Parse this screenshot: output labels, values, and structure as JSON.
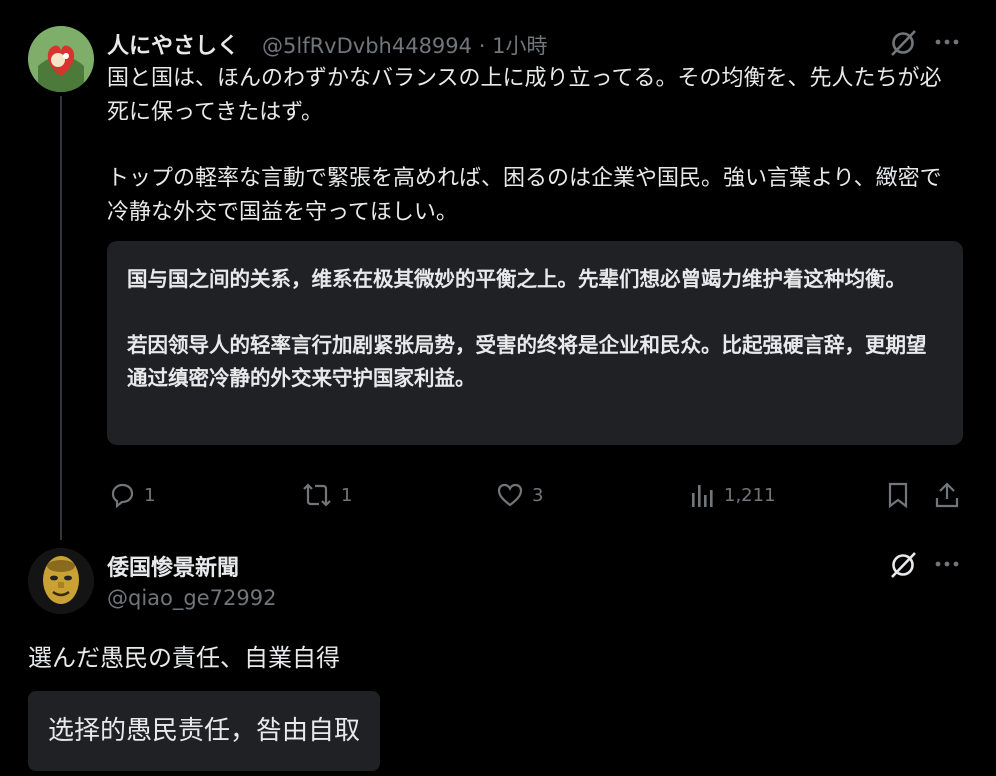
{
  "post1": {
    "display_name": "人にやさしく",
    "handle": "@5lfRvDvbh448994",
    "separator": "·",
    "time": "1小時",
    "text_p1": "国と国は、ほんのわずかなバランスの上に成り立ってる。その均衡を、先人たちが必死に保ってきたはず。",
    "text_p2": "トップの軽率な言動で緊張を高めれば、困るのは企業や国民。強い言葉より、緻密で冷静な外交で国益を守ってほしい。",
    "translation_p1": "国与国之间的关系，维系在极其微妙的平衡之上。先辈们想必曾竭力维护着这种均衡。",
    "translation_p2": "若因领导人的轻率言行加剧紧张局势，受害的终将是企业和民众。比起强硬言辞，更期望通过缜密冷静的外交来守护国家利益。",
    "actions": {
      "replies": "1",
      "reposts": "1",
      "likes": "3",
      "views": "1,211"
    }
  },
  "post2": {
    "display_name": "倭国惨景新聞",
    "handle": "@qiao_ge72992",
    "text": "選んだ愚民の責任、自業自得",
    "translation": "选择的愚民责任，咎由自取"
  },
  "icons": {
    "grok": "grok-slash-icon",
    "more": "more-dots-icon",
    "reply": "reply-bubble-icon",
    "repost": "repost-arrows-icon",
    "like": "heart-icon",
    "views": "bar-chart-icon",
    "bookmark": "bookmark-icon",
    "share": "share-upload-icon"
  },
  "colors": {
    "background": "#000000",
    "text": "#e7e9ea",
    "muted": "#71767b",
    "translation_bg": "#202124"
  }
}
